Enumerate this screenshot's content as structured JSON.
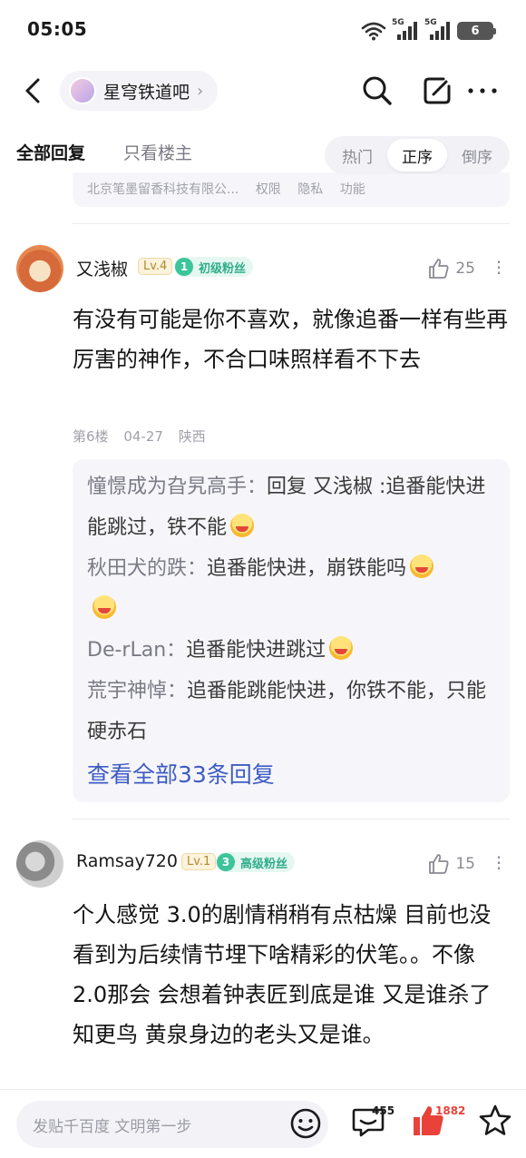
{
  "status_bar": {
    "time": "05:05",
    "signal_1": "5G",
    "signal_2": "5G",
    "battery": "6"
  },
  "nav": {
    "forum_name": "星穹铁道吧"
  },
  "tabs": {
    "all_replies": "全部回复",
    "only_op": "只看楼主",
    "sort": [
      "热门",
      "正序",
      "倒序"
    ],
    "active_sort": "正序"
  },
  "prev_card_footer": {
    "company": "北京笔墨留香科技有限公...",
    "rights": "权限",
    "privacy": "隐私",
    "features": "功能"
  },
  "post1": {
    "username": "又浅椒",
    "level": "Lv.4",
    "fan_level": "1",
    "fan_title": "初级粉丝",
    "likes": "25",
    "text": "有没有可能是你不喜欢，就像追番一样有些再厉害的神作，不合口味照样看不下去",
    "floor": "第6楼",
    "date": "04-27",
    "location": "陕西",
    "replies": [
      {
        "name": "憧憬成为旮旯高手：",
        "text": "回复 又浅椒 :追番能快进能跳过，铁不能"
      },
      {
        "name": "秋田犬的跌：",
        "text": "追番能快进，崩铁能吗"
      },
      {
        "name": "De-rLan：",
        "text": "追番能快进跳过"
      },
      {
        "name": "荒宇神悼：",
        "text": "追番能跳能快进，你铁不能，只能硬赤石"
      }
    ],
    "view_all": "查看全部33条回复"
  },
  "post2": {
    "username": "Ramsay720",
    "level": "Lv.1",
    "fan_level": "3",
    "fan_title": "高级粉丝",
    "likes": "15",
    "text": "个人感觉 3.0的剧情稍稍有点枯燥 目前也没看到为后续情节埋下啥精彩的伏笔。。不像2.0那会 会想着钟表匠到底是谁 又是谁杀了知更鸟 黄泉身边的老头又是谁。"
  },
  "bottom_bar": {
    "placeholder": "发贴千百度 文明第一步",
    "comment_count": "455",
    "like_count": "1882"
  },
  "colors": {
    "accent_blue": "#3d5cc4",
    "fan_green": "#3cc49a",
    "like_red": "#e8423a"
  }
}
